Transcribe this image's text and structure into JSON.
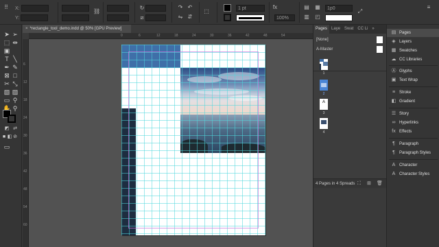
{
  "control_bar": {
    "x_label": "X:",
    "y_label": "Y:",
    "stroke_weight": "1 pt",
    "opacity": "100%",
    "zoom_small": "100%",
    "corner_size": "1p0",
    "icons": [
      "reference-point-icon",
      "rotate-icon",
      "flip-icon",
      "fill-icon",
      "stroke-icon",
      "effects-icon"
    ]
  },
  "document_tab": {
    "title": "*rectangle_tool_demo.indd @ 50% [GPU Preview]",
    "close": "×"
  },
  "ruler": {
    "top_ticks": [
      "0",
      "6",
      "12",
      "18",
      "24",
      "30",
      "36",
      "42",
      "48",
      "54"
    ],
    "left_ticks": [
      "6",
      "12",
      "18",
      "24",
      "30",
      "36",
      "42",
      "48",
      "54",
      "60"
    ]
  },
  "pages_panel": {
    "tabs": [
      "Pages",
      "Laye",
      "Swat",
      "CC Li"
    ],
    "none_label": "[None]",
    "master_label": "A-Master",
    "page_numbers": [
      "1",
      "2",
      "3",
      "4"
    ],
    "footer": "4 Pages in 4 Spreads"
  },
  "dock": {
    "items": [
      {
        "label": "Pages",
        "icon": "pages-icon"
      },
      {
        "label": "Layers",
        "icon": "layers-icon"
      },
      {
        "label": "Swatches",
        "icon": "swatches-icon"
      },
      {
        "label": "CC Libraries",
        "icon": "cc-libraries-icon"
      },
      {
        "label": "Glyphs",
        "icon": "glyphs-icon"
      },
      {
        "label": "Text Wrap",
        "icon": "text-wrap-icon"
      },
      {
        "label": "Stroke",
        "icon": "stroke-icon"
      },
      {
        "label": "Gradient",
        "icon": "gradient-icon"
      },
      {
        "label": "Story",
        "icon": "story-icon"
      },
      {
        "label": "Hyperlinks",
        "icon": "hyperlinks-icon"
      },
      {
        "label": "Effects",
        "icon": "effects-icon"
      },
      {
        "label": "Paragraph",
        "icon": "paragraph-icon"
      },
      {
        "label": "Paragraph Styles",
        "icon": "paragraph-styles-icon"
      },
      {
        "label": "Character",
        "icon": "character-icon"
      },
      {
        "label": "Character Styles",
        "icon": "character-styles-icon"
      }
    ]
  },
  "colors": {
    "accent_blue": "#3f6fa8",
    "dark_column": "#1d2d40",
    "guide_cyan": "#4fd7dc"
  }
}
